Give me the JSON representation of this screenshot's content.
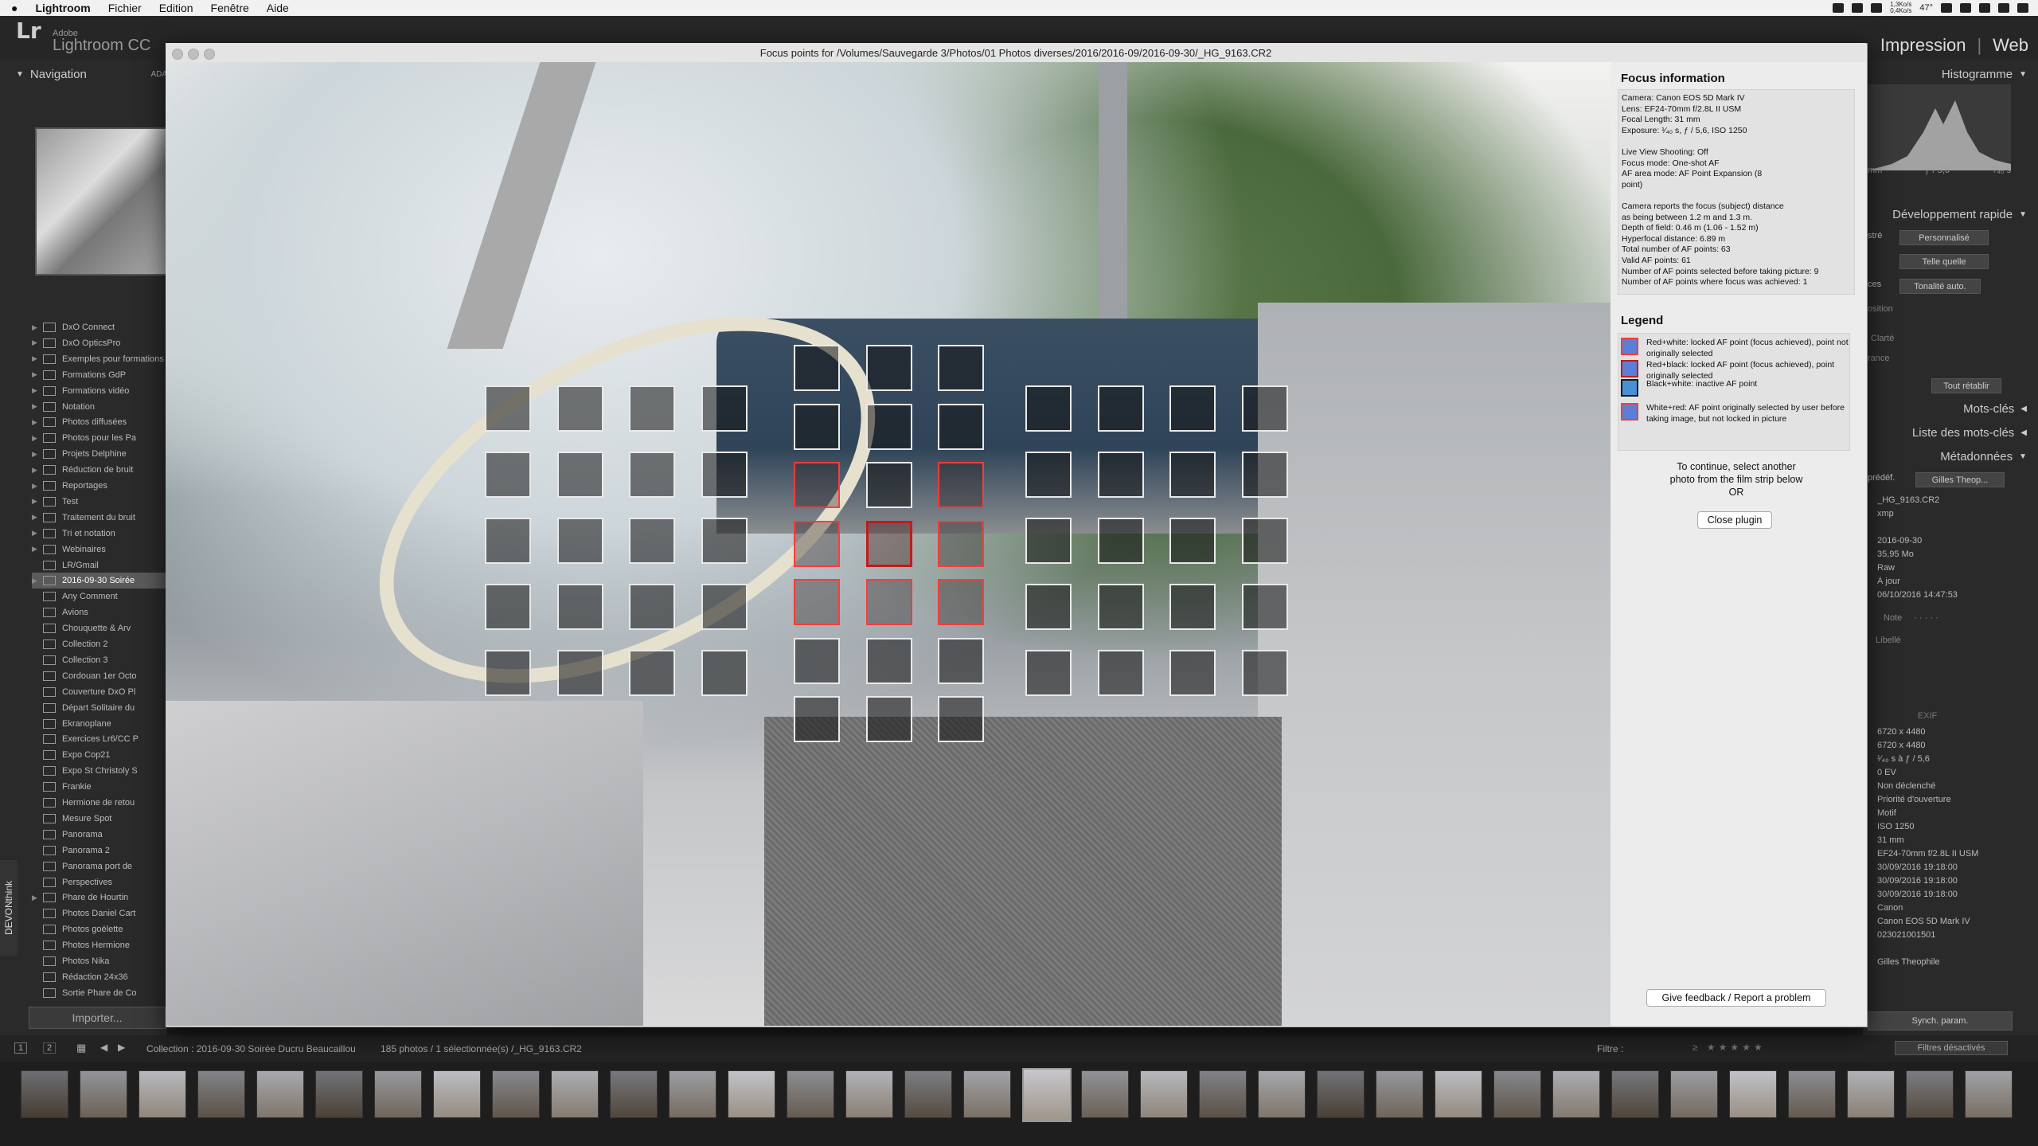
{
  "menubar": {
    "app_name": "Lightroom",
    "items": [
      "Fichier",
      "Edition",
      "Fenêtre",
      "Aide"
    ],
    "net_up": "1,3Ko/s",
    "net_down": "0,4Ko/s",
    "temperature": "47°"
  },
  "lightroom": {
    "logo": "Lr",
    "brand_line1": "Adobe",
    "brand_line2": "Lightroom CC",
    "modules": [
      "Impression",
      "Web"
    ],
    "module_separator": "|"
  },
  "left_panel": {
    "navigator_title": "Navigation",
    "navigator_zoom": "ADA",
    "collections": [
      {
        "name": "DxO Connect",
        "expand": true
      },
      {
        "name": "DxO OpticsPro",
        "expand": true
      },
      {
        "name": "Exemples pour formations",
        "expand": true
      },
      {
        "name": "Formations GdP",
        "expand": true
      },
      {
        "name": "Formations vidéo",
        "expand": true
      },
      {
        "name": "Notation",
        "expand": true
      },
      {
        "name": "Photos diffusées",
        "expand": true
      },
      {
        "name": "Photos pour les Pa",
        "expand": true
      },
      {
        "name": "Projets Delphine",
        "expand": true
      },
      {
        "name": "Réduction de bruit",
        "expand": true
      },
      {
        "name": "Reportages",
        "expand": true
      },
      {
        "name": "Test",
        "expand": true
      },
      {
        "name": "Traitement du bruit",
        "expand": true
      },
      {
        "name": "Tri et notation",
        "expand": true
      },
      {
        "name": "Webinaires",
        "expand": true
      },
      {
        "name": "LR/Gmail",
        "expand": false
      },
      {
        "name": "2016-09-30 Soirée",
        "expand": true,
        "selected": true
      },
      {
        "name": "Any Comment",
        "expand": false
      },
      {
        "name": "Avions",
        "expand": false
      },
      {
        "name": "Chouquette & Arv",
        "expand": false
      },
      {
        "name": "Collection 2",
        "expand": false
      },
      {
        "name": "Collection 3",
        "expand": false
      },
      {
        "name": "Cordouan 1er Octo",
        "expand": false
      },
      {
        "name": "Couverture DxO Pl",
        "expand": false
      },
      {
        "name": "Départ Solitaire du",
        "expand": false
      },
      {
        "name": "Ekranoplane",
        "expand": false
      },
      {
        "name": "Exercices Lr6/CC P",
        "expand": false
      },
      {
        "name": "Expo Cop21",
        "expand": false
      },
      {
        "name": "Expo St Christoly S",
        "expand": false
      },
      {
        "name": "Frankie",
        "expand": false
      },
      {
        "name": "Hermione de retou",
        "expand": false
      },
      {
        "name": "Mesure Spot",
        "expand": false
      },
      {
        "name": "Panorama",
        "expand": false
      },
      {
        "name": "Panorama 2",
        "expand": false
      },
      {
        "name": "Panorama port de",
        "expand": false
      },
      {
        "name": "Perspectives",
        "expand": false
      },
      {
        "name": "Phare de Hourtin",
        "expand": true
      },
      {
        "name": "Photos Daniel Cart",
        "expand": false
      },
      {
        "name": "Photos goëlette",
        "expand": false
      },
      {
        "name": "Photos Hermione",
        "expand": false
      },
      {
        "name": "Photos Nika",
        "expand": false
      },
      {
        "name": "Rédaction 24x36",
        "expand": false
      },
      {
        "name": "Sortie Phare de Co",
        "expand": false
      }
    ],
    "import_button": "Importer...",
    "devonthink": "DEVONthink"
  },
  "right_panel": {
    "histogram_title": "Histogramme",
    "histo_labels": [
      "mm",
      "ƒ / 5,6",
      "¹⁄₄₀ s"
    ],
    "quick_develop_title": "Développement rapide",
    "preset_label": "stré",
    "preset_value": "Personnalisé",
    "wb_value": "Telle quelle",
    "tone_label": "ces",
    "tone_auto": "Tonalité auto.",
    "exposure_label": "osition",
    "clarity_label": "Clarté",
    "vibrance_label": "rance",
    "reset_all": "Tout rétablir",
    "keywords_title": "Mots-clés",
    "keyword_list_title": "Liste des mots-clés",
    "metadata_title": "Métadonnées",
    "metadata_preset_label": "prédéf.",
    "metadata_preset": "Gilles Theop...",
    "meta_values": [
      "_HG_9163.CR2",
      "xmp",
      "",
      "2016-09-30",
      "35,95 Mo",
      "Raw",
      "À jour",
      "06/10/2016 14:47:53"
    ],
    "note_label": "Note",
    "note_dots": "· · · · ·",
    "label_label": "Libellé",
    "exif_title": "EXIF",
    "exif_values": [
      "6720 x 4480",
      "6720 x 4480",
      "¹⁄₄₀ s à ƒ / 5,6",
      "0 EV",
      "Non déclenché",
      "Priorité d'ouverture",
      "Motif",
      "ISO 1250",
      "31 mm",
      "EF24-70mm f/2.8L II USM",
      "30/09/2016 19:18:00",
      "30/09/2016 19:18:00",
      "30/09/2016 19:18:00",
      "Canon",
      "Canon EOS 5D Mark IV",
      "023021001501",
      "",
      "Gilles Theophile"
    ],
    "sync_button": "Synch. param."
  },
  "filterbar": {
    "page1": "1",
    "page2": "2",
    "collection": "Collection : 2016-09-30 Soirée Ducru Beaucaillou",
    "count": "185 photos / 1 sélectionnée(s) /_HG_9163.CR2",
    "filter_label": "Filtre :",
    "filters_off": "Filtres désactivés"
  },
  "plugin": {
    "title": "Focus points for /Volumes/Sauvegarde 3/Photos/01 Photos diverses/2016/2016-09/2016-09-30/_HG_9163.CR2",
    "focus_info_title": "Focus information",
    "info_lines": [
      "Camera: Canon EOS 5D Mark IV",
      "Lens: EF24-70mm f/2.8L II USM",
      "Focal Length: 31 mm",
      "Exposure: ¹⁄₄₀ s, ƒ / 5,6, ISO 1250",
      "",
      "Live View Shooting: Off",
      "Focus mode: One-shot AF",
      "AF area mode: AF Point Expansion (8",
      "  point)",
      "",
      "Camera reports the focus (subject) distance",
      "as being between 1.2 m and 1.3 m.",
      "Depth of field: 0.46 m (1.06 - 1.52 m)",
      "Hyperfocal distance: 6.89 m",
      "Total number of AF points: 63",
      "Valid AF points: 61",
      "Number of AF points selected before taking picture: 9",
      "Number of AF points where focus was achieved: 1"
    ],
    "legend_title": "Legend",
    "legend": [
      {
        "text": "Red+white: locked AF point (focus achieved), point not originally selected",
        "fill": "#5b7fd6",
        "border": "#ff3b3b"
      },
      {
        "text": "Red+black: locked AF point (focus achieved), point originally selected",
        "fill": "#5b7fd6",
        "border": "#c21b1b"
      },
      {
        "text": "Black+white: inactive AF point",
        "fill": "#4a8fd6",
        "border": "#1a1a1a"
      },
      {
        "text": "White+red: AF point originally selected by user before taking image, but not locked in picture",
        "fill": "#5b7fd6",
        "border": "#ff3b3b"
      }
    ],
    "continue_line1": "To continue, select another",
    "continue_line2": "photo from the film strip below",
    "continue_line3": "OR",
    "close_button": "Close plugin",
    "feedback_button": "Give feedback / Report a problem"
  },
  "af_points": {
    "inactive_color": "#e9e9e9",
    "selected_color": "#ff3b3b",
    "focus_color": "#c21b1b",
    "left_grid": {
      "cols": 4,
      "rows": 5
    },
    "center_grid": {
      "cols": 3,
      "rows": 7,
      "selected": [
        [
          2,
          0
        ],
        [
          2,
          2
        ],
        [
          3,
          0
        ],
        [
          3,
          2
        ],
        [
          4,
          0
        ],
        [
          4,
          1
        ],
        [
          4,
          2
        ]
      ],
      "focus": [
        [
          3,
          1
        ]
      ]
    },
    "right_grid": {
      "cols": 4,
      "rows": 5
    }
  }
}
